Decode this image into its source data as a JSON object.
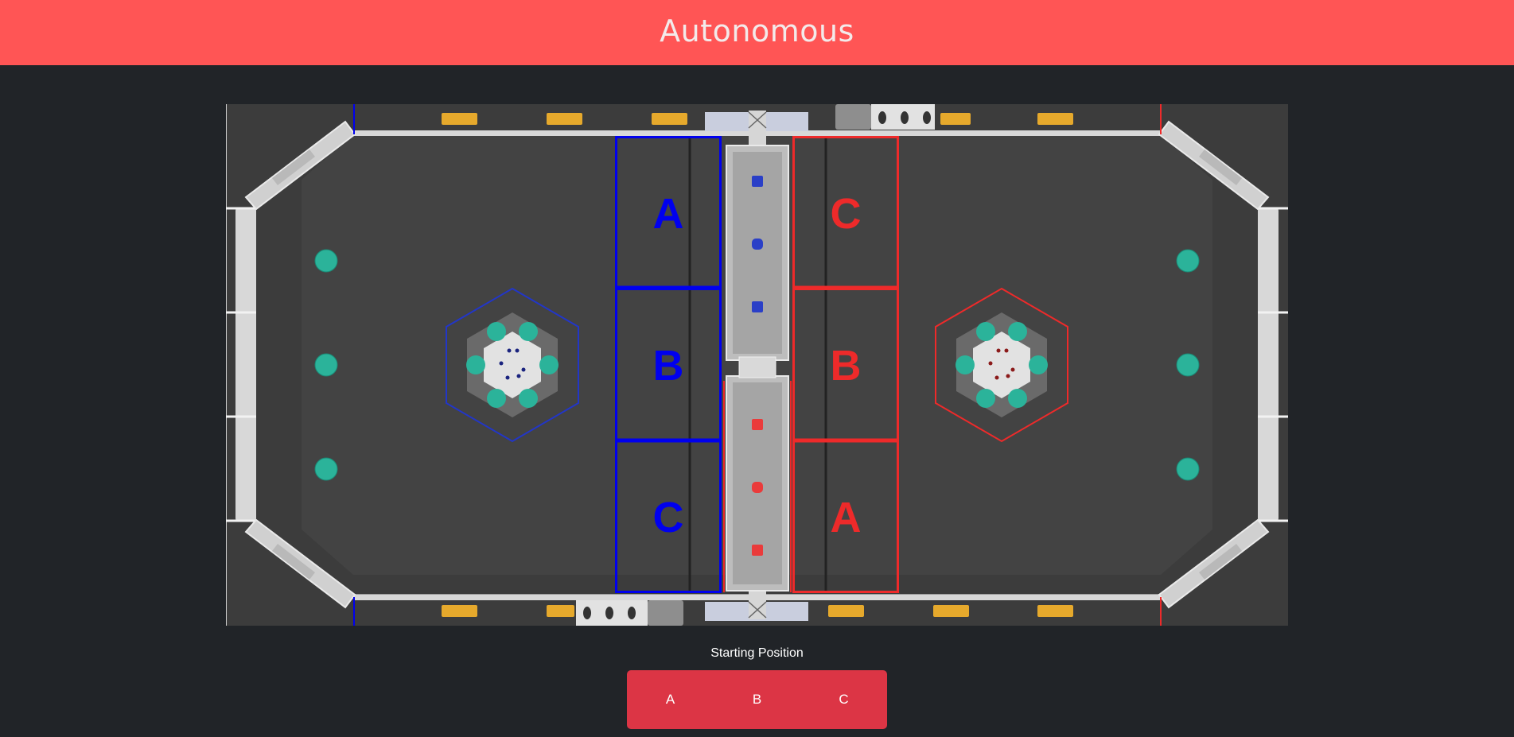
{
  "header": {
    "title": "Autonomous"
  },
  "field": {
    "blue_zones": [
      "A",
      "B",
      "C"
    ],
    "red_zones": [
      "C",
      "B",
      "A"
    ],
    "colors": {
      "blue_alliance": "#0000ee",
      "red_alliance": "#ee2a2a",
      "field_floor": "#424242",
      "field_wall": "#d8d8d8",
      "ball": "#2bb39a",
      "yellow_marker": "#e6a92c"
    }
  },
  "starting_position": {
    "label": "Starting Position",
    "options": [
      "A",
      "B",
      "C"
    ],
    "button_color": "#dc3545"
  }
}
